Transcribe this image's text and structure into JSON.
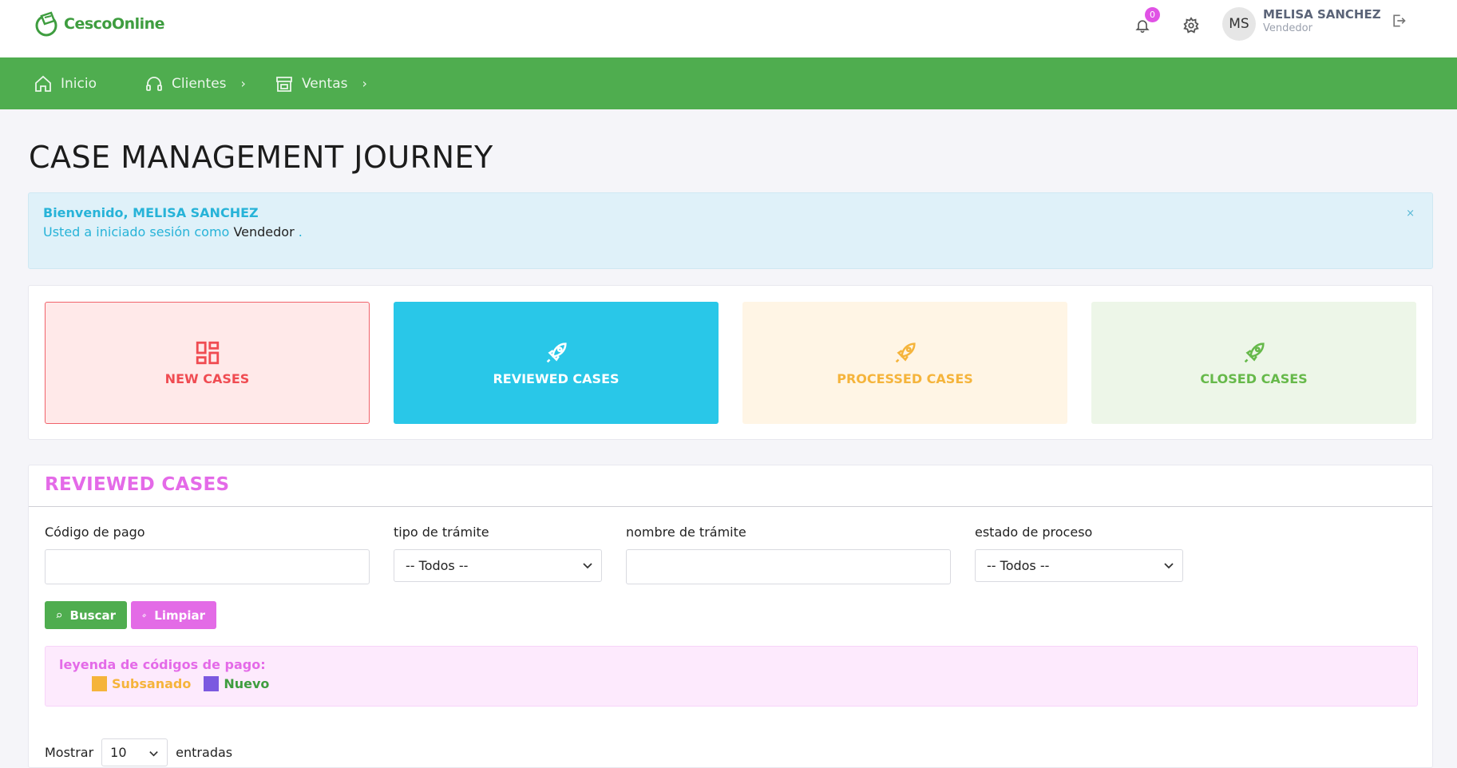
{
  "header": {
    "logo_text": "CescoOnline",
    "notification_count": "0",
    "avatar_initials": "MS",
    "user_name": "MELISA SANCHEZ",
    "user_role": "Vendedor"
  },
  "nav": {
    "items": [
      {
        "label": "Inicio",
        "icon": "home-icon"
      },
      {
        "label": "Clientes",
        "icon": "headset-icon"
      },
      {
        "label": "Ventas",
        "icon": "store-icon"
      }
    ]
  },
  "page_title": "CASE MANAGEMENT JOURNEY",
  "alert": {
    "title": "Bienvenido, MELISA SANCHEZ",
    "body_prefix": "Usted a iniciado sesión como",
    "body_role": "Vendedor",
    "body_suffix": ".",
    "close": "×"
  },
  "cards": {
    "new": "NEW CASES",
    "reviewed": "REVIEWED CASES",
    "processed": "PROCESSED CASES",
    "closed": "CLOSED CASES"
  },
  "section": {
    "title": "REVIEWED CASES",
    "filters": {
      "codigo_label": "Código de pago",
      "codigo_value": "",
      "tipo_label": "tipo de trámite",
      "tipo_value": "-- Todos --",
      "nombre_label": "nombre de trámite",
      "nombre_value": "",
      "estado_label": "estado de proceso",
      "estado_value": "-- Todos --"
    },
    "buttons": {
      "search": "Buscar",
      "clear": "Limpiar"
    },
    "legend": {
      "title": "leyenda de códigos de pago:",
      "items": [
        {
          "label": "Subsanado",
          "color": "#f5b43b"
        },
        {
          "label": "Nuevo",
          "color": "#7b59e0"
        }
      ]
    },
    "pagination": {
      "show_label": "Mostrar",
      "page_size": "10",
      "entries_label": "entradas"
    }
  },
  "colors": {
    "brand_green": "#4fad4f",
    "accent_pink": "#e46ae8",
    "info_blue": "#29c7e8"
  }
}
